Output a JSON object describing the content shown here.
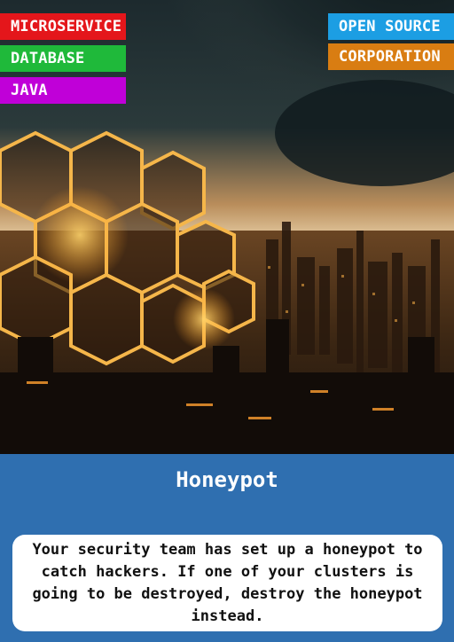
{
  "card": {
    "title": "Honeypot",
    "description": "Your security team has set up a honeypot to catch hackers. If one of your clusters is going to be destroyed, destroy the honeypot instead."
  },
  "tags_left": [
    {
      "label": "MICROSERVICE",
      "color": "#e4161b"
    },
    {
      "label": "DATABASE",
      "color": "#1fb93a"
    },
    {
      "label": "JAVA",
      "color": "#c000d8"
    }
  ],
  "tags_right": [
    {
      "label": "OPEN SOURCE",
      "color": "#1c9ee3"
    },
    {
      "label": "CORPORATION",
      "color": "#d97d12"
    }
  ],
  "colors": {
    "panel_background": "#2f6fb0",
    "text_box": "#ffffff"
  }
}
